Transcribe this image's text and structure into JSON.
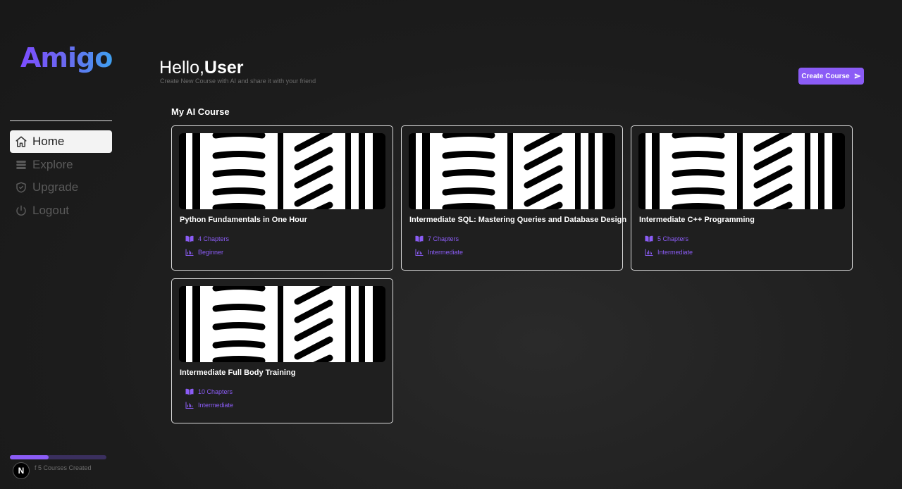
{
  "app": {
    "logo_text": "Amigo"
  },
  "sidebar": {
    "items": [
      {
        "label": "Home",
        "icon": "home-icon",
        "active": true
      },
      {
        "label": "Explore",
        "icon": "stack-icon",
        "active": false
      },
      {
        "label": "Upgrade",
        "icon": "shield-check-icon",
        "active": false
      },
      {
        "label": "Logout",
        "icon": "power-icon",
        "active": false
      }
    ],
    "progress": {
      "fraction": 0.4,
      "text": "2 Out of 5 Courses Created",
      "visible_text": "f 5 Courses Created"
    },
    "badge": "N"
  },
  "header": {
    "greeting": "Hello,",
    "user": "User",
    "subtitle": "Create New Course with AI and share it with your friend",
    "create_button": "Create Course"
  },
  "section_title": "My AI Course",
  "courses": [
    {
      "title": "Python Fundamentals in One Hour",
      "chapters": "4 Chapters",
      "level": "Beginner"
    },
    {
      "title": "Intermediate SQL: Mastering Queries and Database Design",
      "chapters": "7 Chapters",
      "level": "Intermediate"
    },
    {
      "title": "Intermediate C++ Programming",
      "chapters": "5 Chapters",
      "level": "Intermediate"
    },
    {
      "title": "Intermediate Full Body Training",
      "chapters": "10 Chapters",
      "level": "Intermediate"
    }
  ],
  "colors": {
    "accent": "#8b5cf6",
    "background": "#1c1c1c"
  }
}
